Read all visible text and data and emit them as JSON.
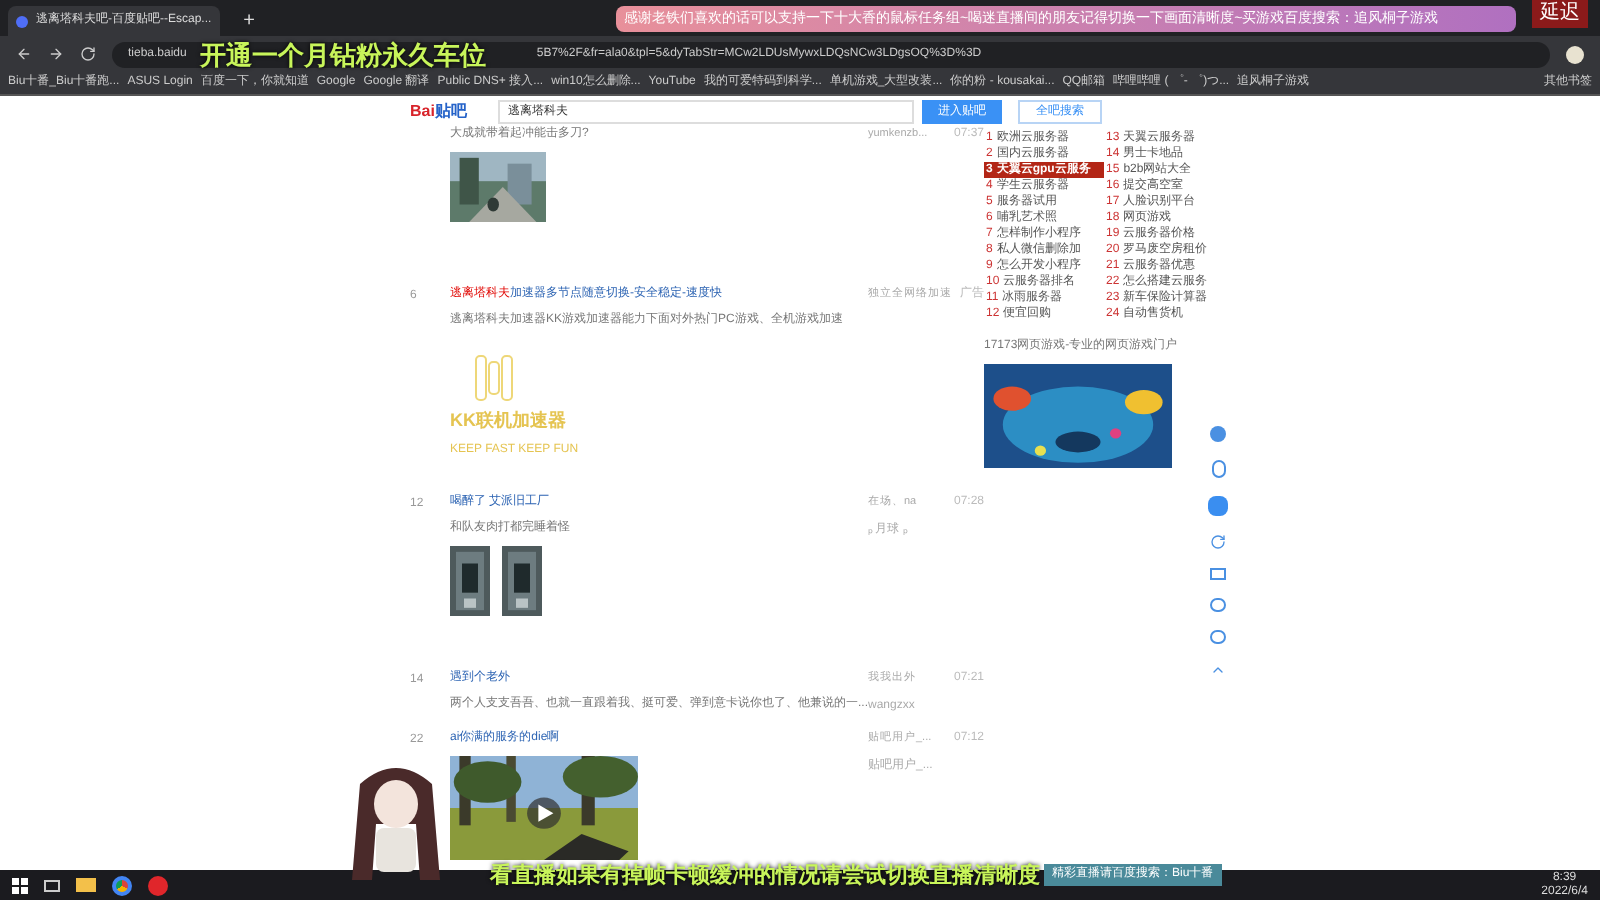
{
  "browser": {
    "tab_title": "逃离塔科夫吧-百度贴吧--Escap...",
    "new_tab": "+",
    "url_head": "tieba.baidu",
    "url_tail": "5B7%2F&fr=ala0&tpl=5&dyTabStr=MCw2LDUsMywxLDQsNCw3LDgsOQ%3D%3D",
    "bookmarks": [
      {
        "label": "Biu十番_Biu十番跑..."
      },
      {
        "label": "ASUS Login"
      },
      {
        "label": "百度一下，你就知道"
      },
      {
        "label": "Google"
      },
      {
        "label": "Google 翻译"
      },
      {
        "label": "Public DNS+ 接入..."
      },
      {
        "label": "win10怎么删除..."
      },
      {
        "label": "YouTube"
      },
      {
        "label": "我的可爱特码到科学..."
      },
      {
        "label": "单机游戏_大型改装..."
      },
      {
        "label": "你的粉 - kousakai..."
      },
      {
        "label": "QQ邮箱"
      },
      {
        "label": "哔哩哔哩 ( ゜- ゜)つ..."
      },
      {
        "label": "追风桐子游戏"
      }
    ],
    "other_bookmarks": "其他书签"
  },
  "header": {
    "logo_a": "Bai",
    "logo_b": "贴吧",
    "search_value": "逃离塔科夫",
    "enter_button": "进入贴吧",
    "search_all_button": "全吧搜索"
  },
  "posts": [
    {
      "author": "yumkenzb...",
      "time": "07:37",
      "description": "大成就带着起冲能击多刀?"
    },
    {
      "kind": "ad",
      "number": "6",
      "title_highlight": "逃离塔科夫",
      "title": "加速器多节点随意切换-安全稳定-速度快",
      "author": "独立全网络加速",
      "time": "广告",
      "description": "逃离塔科夫加速器KK游戏加速器能力下面对外热门PC游戏、全机游戏加速",
      "brand": "KK联机加速器",
      "slogan": "KEEP FAST KEEP FUN"
    },
    {
      "kind": "images",
      "number": "12",
      "title": "喝醉了 艾派旧工厂",
      "author": "在场、na",
      "description": "和队友肉打都完睡着怪",
      "sub_author": "ₚ 月球 ₚ",
      "sub_time": "07:28"
    },
    {
      "kind": "text",
      "number": "14",
      "title": "遇到个老外",
      "author": "我我出外",
      "description": "两个人支支吾吾、也就一直跟着我、挺可爱、弹到意卡说你也了、他兼说的一...",
      "sub_author": "wangzxx",
      "sub_time": "07:21"
    },
    {
      "kind": "video",
      "number": "22",
      "title": "ai你满的服务的die啊",
      "author": "贴吧用户_...",
      "sub_author": "贴吧用户_...",
      "sub_time": "07:12"
    }
  ],
  "hot_list": [
    {
      "number": "1",
      "label": "欧洲云服务器",
      "selected": false
    },
    {
      "number": "2",
      "label": "国内云服务器",
      "selected": false
    },
    {
      "number": "3",
      "label": "天翼云gpu云服务",
      "selected": true
    },
    {
      "number": "4",
      "label": "学生云服务器",
      "selected": false
    },
    {
      "number": "5",
      "label": "服务器试用",
      "selected": false
    },
    {
      "number": "6",
      "label": "哺乳艺术照",
      "selected": false
    },
    {
      "number": "7",
      "label": "怎样制作小程序",
      "selected": false
    },
    {
      "number": "8",
      "label": "私人微信删除加",
      "selected": false
    },
    {
      "number": "9",
      "label": "怎么开发小程序",
      "selected": false
    },
    {
      "number": "10",
      "label": "云服务器排名",
      "selected": false
    },
    {
      "number": "11",
      "label": "冰雨服务器",
      "selected": false
    },
    {
      "number": "12",
      "label": "便宜回购",
      "selected": false
    },
    {
      "number": "13",
      "label": "天翼云服务器",
      "selected": false
    },
    {
      "number": "14",
      "label": "男士卡地品",
      "selected": false
    },
    {
      "number": "15",
      "label": "b2b网站大全",
      "selected": false
    },
    {
      "number": "16",
      "label": "提交高空室",
      "selected": false
    },
    {
      "number": "17",
      "label": "人脸识别平台",
      "selected": false
    },
    {
      "number": "18",
      "label": "网页游戏",
      "selected": false
    },
    {
      "number": "19",
      "label": "云服务器价格",
      "selected": false
    },
    {
      "number": "20",
      "label": "罗马废空房租价",
      "selected": false
    },
    {
      "number": "21",
      "label": "云服务器优惠",
      "selected": false
    },
    {
      "number": "22",
      "label": "怎么搭建云服务",
      "selected": false
    },
    {
      "number": "23",
      "label": "新车保险计算器",
      "selected": false
    },
    {
      "number": "24",
      "label": "自动售货机",
      "selected": false
    }
  ],
  "ad_title": "17173网页游戏-专业的网页游戏门户",
  "stream": {
    "top_caption": "开通一个月钻粉永久车位",
    "banner": "感谢老铁们喜欢的话可以支持一下十大香的鼠标任务组~喝迷直播间的朋友记得切换一下画面清晰度~买游戏百度搜索：追风桐子游戏",
    "delay_badge": "延迟",
    "bottom_caption": "看直播如果有掉帧卡顿缓冲的情况请尝试切换直播清晰度",
    "search_hint": "精彩直播请百度搜索：Biu十番"
  },
  "taskbar": {
    "time": "8:39",
    "date": "2022/6/4"
  }
}
